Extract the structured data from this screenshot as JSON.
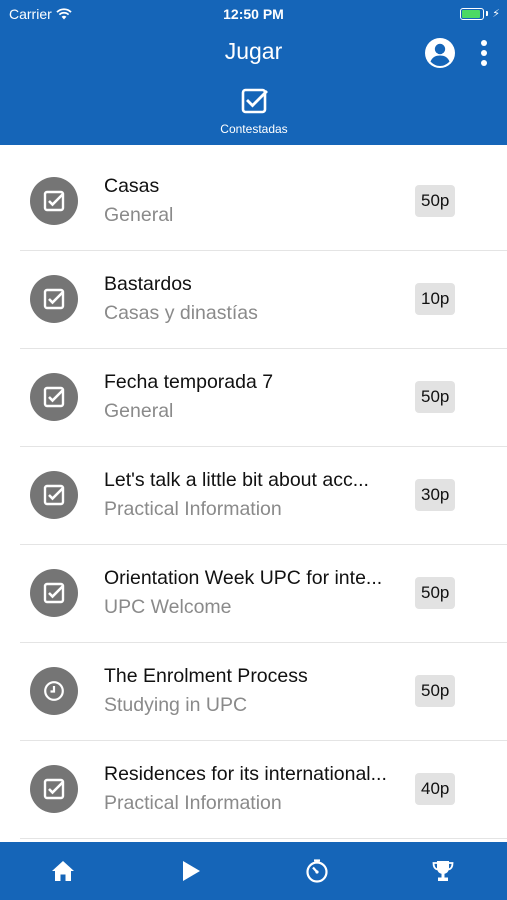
{
  "status_bar": {
    "carrier": "Carrier",
    "time": "12:50 PM",
    "battery_level": 0.9
  },
  "header": {
    "title": "Jugar",
    "tab_label": "Contestadas",
    "account_icon": "account-circle-icon",
    "menu_icon": "more-vertical-icon"
  },
  "colors": {
    "primary": "#1565b8",
    "row_icon_bg": "#757575",
    "points_bg": "#e2e2e2",
    "subtitle": "#8a8a8a"
  },
  "items": [
    {
      "title": "Casas",
      "subtitle": "General",
      "points": "50p",
      "icon": "check-box-icon"
    },
    {
      "title": "Bastardos",
      "subtitle": "Casas y dinastías",
      "points": "10p",
      "icon": "check-box-icon"
    },
    {
      "title": "Fecha temporada 7",
      "subtitle": "General",
      "points": "50p",
      "icon": "check-box-icon"
    },
    {
      "title": "Let's talk a little bit about acc...",
      "subtitle": "Practical Information",
      "points": "30p",
      "icon": "check-box-icon"
    },
    {
      "title": "Orientation Week UPC for inte...",
      "subtitle": "UPC Welcome",
      "points": "50p",
      "icon": "check-box-icon"
    },
    {
      "title": "The Enrolment Process",
      "subtitle": "Studying in UPC",
      "points": "50p",
      "icon": "clock-icon"
    },
    {
      "title": "Residences for its international...",
      "subtitle": "Practical Information",
      "points": "40p",
      "icon": "check-box-icon"
    }
  ],
  "bottom_nav": [
    {
      "name": "home",
      "icon": "home-icon"
    },
    {
      "name": "play",
      "icon": "play-icon"
    },
    {
      "name": "timer",
      "icon": "timer-icon"
    },
    {
      "name": "ranking",
      "icon": "trophy-icon"
    }
  ]
}
